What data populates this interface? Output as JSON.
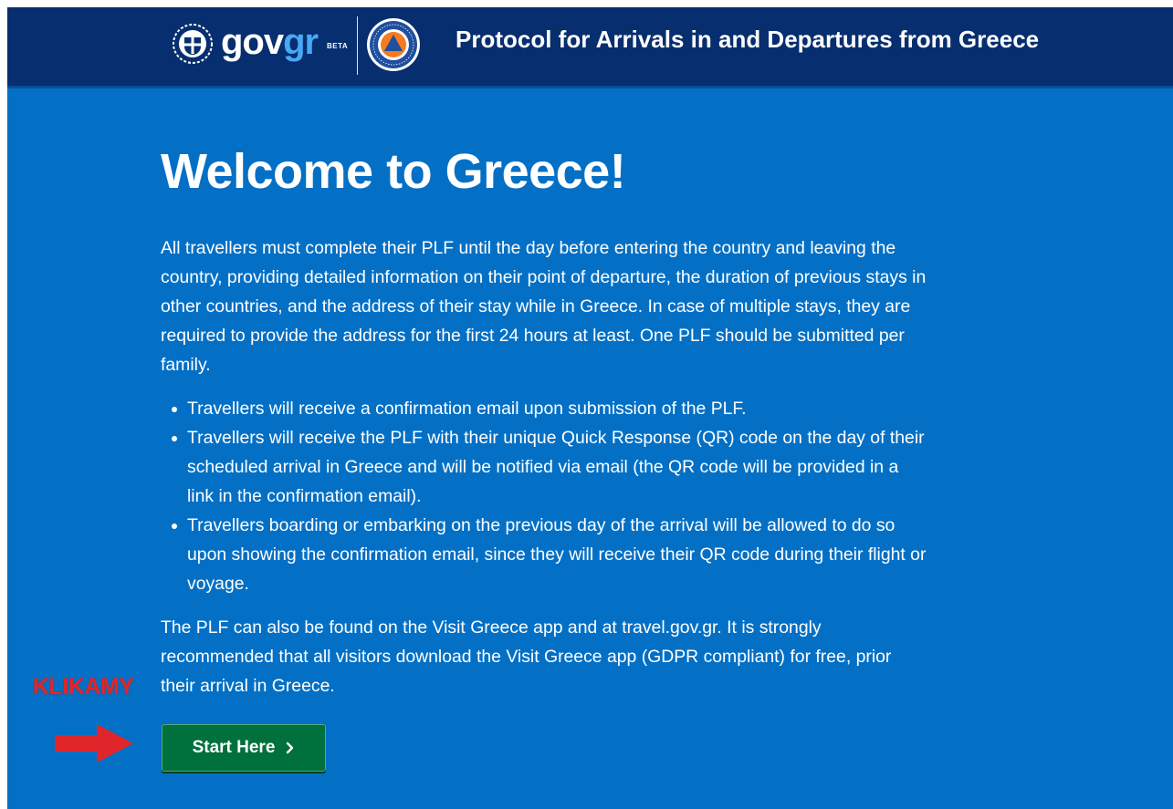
{
  "header": {
    "logo_gov": "gov",
    "logo_gr": "gr",
    "logo_badge": "BETA",
    "title": "Protocol for Arrivals in and Departures from Greece",
    "emblem_icon": "greek-coat-of-arms-icon",
    "seal_icon": "civil-protection-seal-icon",
    "background_color": "#072e6e"
  },
  "main": {
    "title": "Welcome to Greece!",
    "intro": "All travellers must complete their PLF until the day before entering the country and leaving the country, providing detailed information on their point of departure, the duration of previous stays in other countries, and the address of their stay while in Greece. In case of multiple stays, they are required to provide the address for the first 24 hours at least. One PLF should be submitted per family.",
    "bullets": [
      "Travellers will receive a confirmation email upon submission of the PLF.",
      "Travellers will receive the PLF with their unique Quick Response (QR) code on the day of their scheduled arrival in Greece and will be notified via email (the QR code will be provided in a link in the confirmation email).",
      "Travellers boarding or embarking on the previous day of the arrival will be allowed to do so upon showing the confirmation email, since they will receive their QR code during their flight or voyage."
    ],
    "outro": "The PLF can also be found on the Visit Greece app and at travel.gov.gr. It is strongly recommended that all visitors download the Visit Greece app (GDPR compliant) for free, prior their arrival in Greece.",
    "start_button_label": "Start Here",
    "start_button_icon": "chevron-right-icon",
    "background_color": "#0370c6",
    "button_color": "#00703c"
  },
  "annotation": {
    "label": "KLIKAMY",
    "arrow_icon": "red-arrow-right-icon",
    "color": "#e0262a"
  }
}
